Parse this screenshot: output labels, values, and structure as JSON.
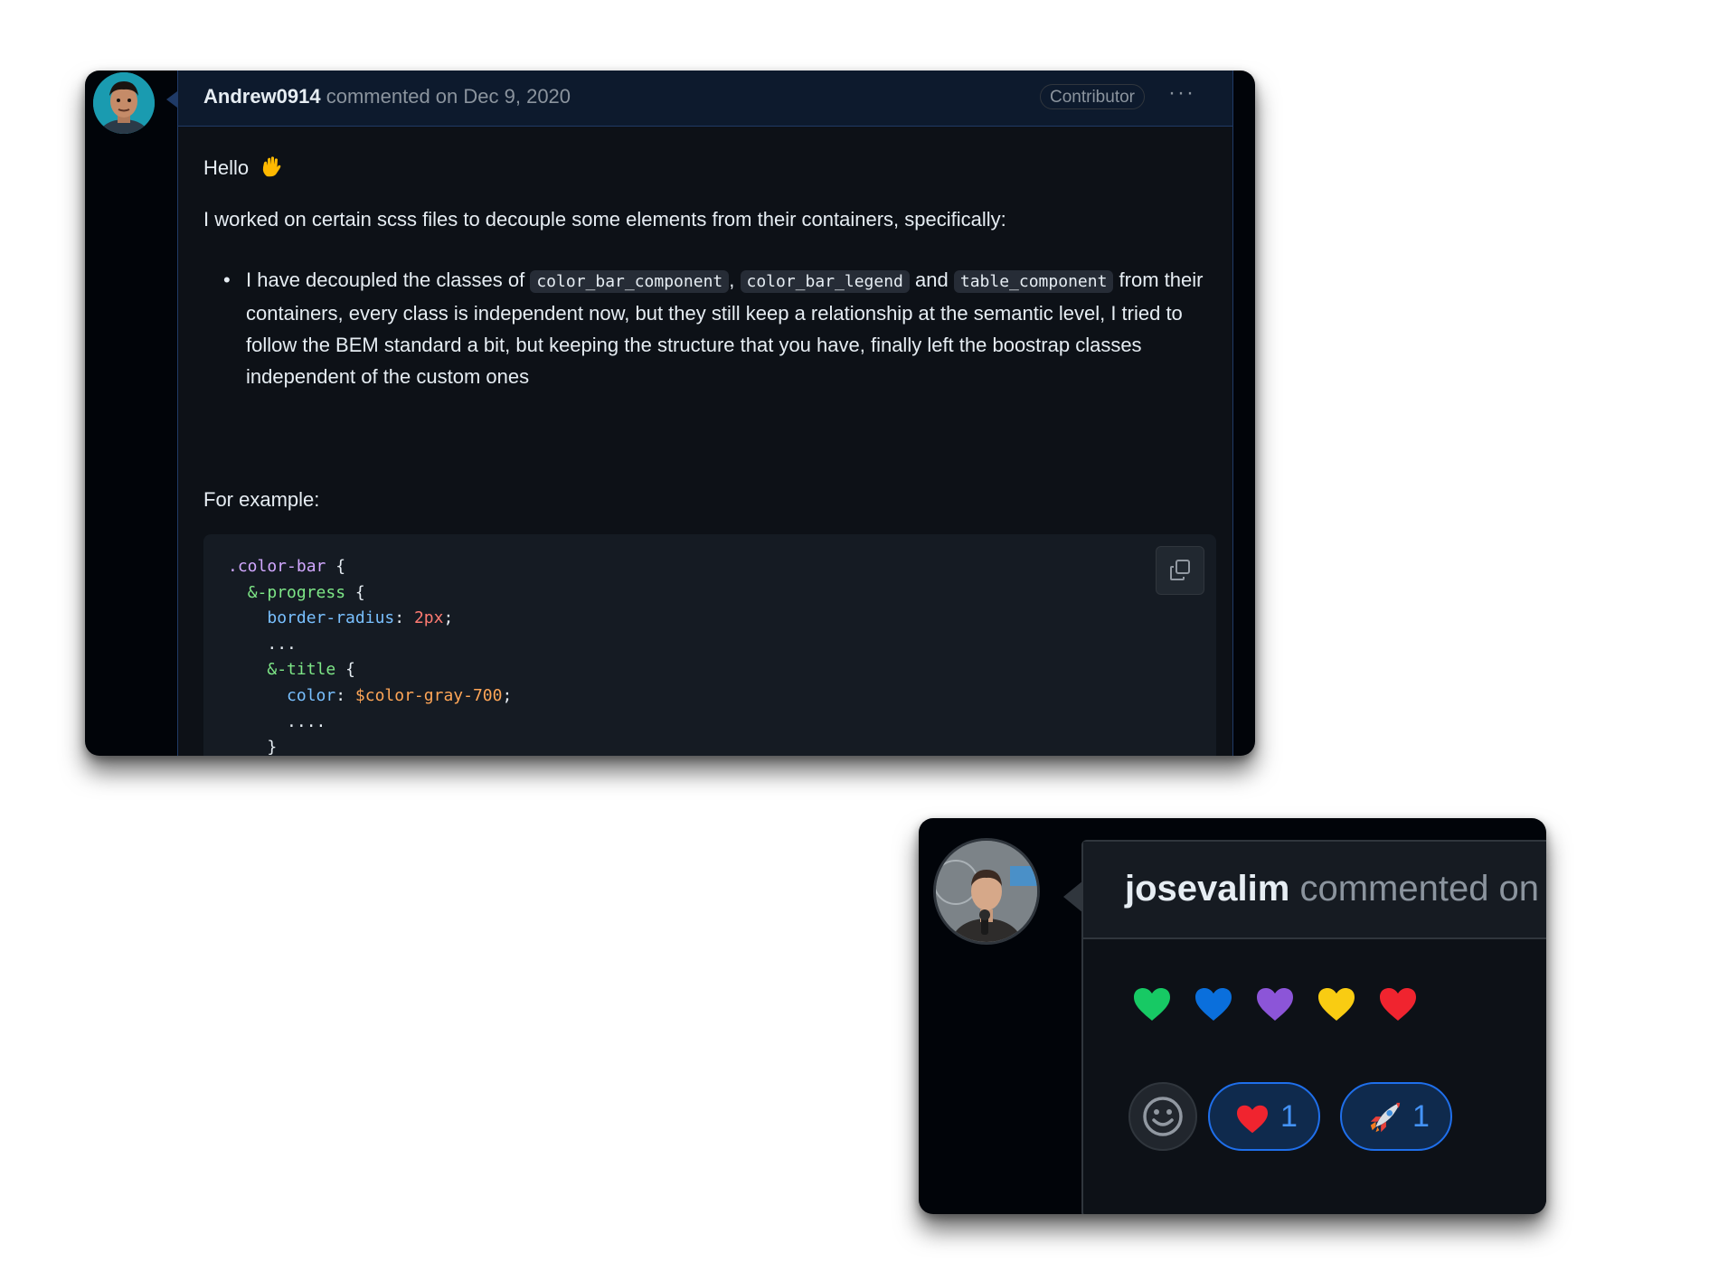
{
  "comment1": {
    "author": "Andrew0914",
    "meta": "commented on Dec 9, 2020",
    "badge": "Contributor",
    "more_label": "···",
    "greeting": "Hello",
    "greeting_emoji_icon": "waving-hand-icon",
    "intro": "I worked on certain scss files to decouple some elements from their containers, specifically:",
    "bullet": {
      "part1": "I have decoupled the classes of",
      "code1": "color_bar_component",
      "sep1": ",",
      "code2": "color_bar_legend",
      "and": "and",
      "code3": "table_component",
      "part2": "from their containers, every class is independent now, but they still keep a relationship at the semantic level, I tried to follow the BEM standard a bit, but keeping the structure that you have, finally left the boostrap classes independent of the custom ones"
    },
    "for_example": "For example:",
    "code_block": {
      "line1_selector": ".color-bar",
      "open_brace": "{",
      "close_brace": "}",
      "line2_nest": "&-progress",
      "line3_prop": "border-radius",
      "line3_value": "2px",
      "line4": "...",
      "line5_nest": "&-title",
      "line6_prop": "color",
      "line6_value": "$color-gray-700",
      "line7": "....",
      "colon": ":",
      "semicolon": ";"
    }
  },
  "comment2": {
    "author": "josevalim",
    "meta": "commented on",
    "hearts": [
      "green-heart-icon",
      "blue-heart-icon",
      "purple-heart-icon",
      "yellow-heart-icon",
      "red-heart-icon"
    ],
    "reactions": [
      {
        "icon": "red-heart-icon",
        "count": "1"
      },
      {
        "icon": "rocket-icon",
        "count": "1"
      }
    ]
  },
  "colors": {
    "background": "#010409",
    "text": "#e6edf3",
    "muted": "#8b949e",
    "accent": "#4493f8"
  }
}
